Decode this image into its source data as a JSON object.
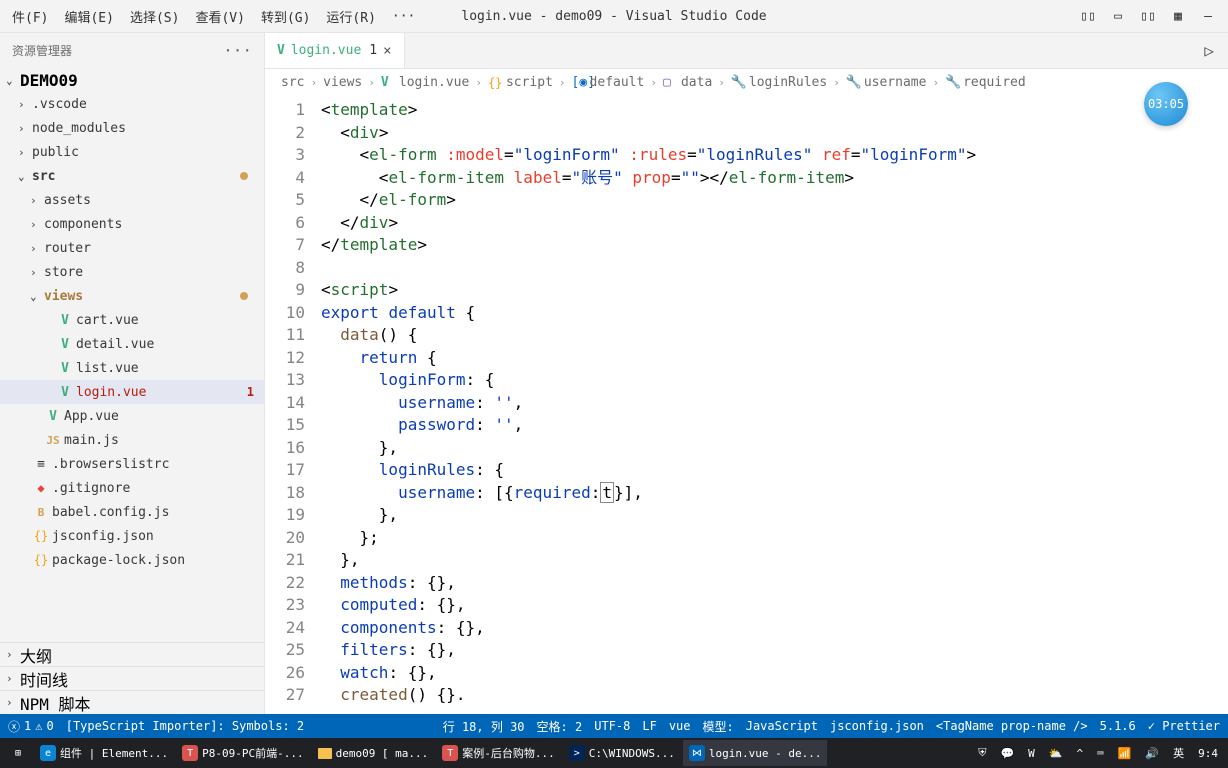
{
  "menubar": {
    "items": [
      "件(F)",
      "编辑(E)",
      "选择(S)",
      "查看(V)",
      "转到(G)",
      "运行(R)"
    ],
    "ellipsis": "···",
    "title": "login.vue - demo09 - Visual Studio Code"
  },
  "sidebar": {
    "header": "资源管理器",
    "project": "DEMO09",
    "tree": [
      {
        "indent": 1,
        "chev": "›",
        "label": ".vscode"
      },
      {
        "indent": 1,
        "chev": "›",
        "label": "node_modules"
      },
      {
        "indent": 1,
        "chev": "›",
        "label": "public"
      },
      {
        "indent": 1,
        "chev": "⌄",
        "label": "src",
        "dot": true,
        "bold": true
      },
      {
        "indent": 2,
        "chev": "›",
        "label": "assets"
      },
      {
        "indent": 2,
        "chev": "›",
        "label": "components"
      },
      {
        "indent": 2,
        "chev": "›",
        "label": "router"
      },
      {
        "indent": 2,
        "chev": "›",
        "label": "store"
      },
      {
        "indent": 2,
        "chev": "⌄",
        "label": "views",
        "dot": true,
        "bold": true,
        "color": "#a87a3c"
      },
      {
        "indent": 3,
        "icon": "V",
        "iconcls": "icon-v",
        "label": "cart.vue"
      },
      {
        "indent": 3,
        "icon": "V",
        "iconcls": "icon-v",
        "label": "detail.vue"
      },
      {
        "indent": 3,
        "icon": "V",
        "iconcls": "icon-v",
        "label": "list.vue"
      },
      {
        "indent": 3,
        "icon": "V",
        "iconcls": "icon-v",
        "label": "login.vue",
        "selected": true,
        "badge": "1",
        "color": "#b5200d"
      },
      {
        "indent": 2,
        "icon": "V",
        "iconcls": "icon-v",
        "label": "App.vue"
      },
      {
        "indent": 2,
        "icon": "JS",
        "iconcls": "icon-js2",
        "label": "main.js"
      },
      {
        "indent": 1,
        "icon": "≡",
        "iconcls": "",
        "label": ".browserslistrc"
      },
      {
        "indent": 1,
        "icon": "◆",
        "iconcls": "icon-git",
        "label": ".gitignore"
      },
      {
        "indent": 1,
        "icon": "B",
        "iconcls": "icon-js2",
        "label": "babel.config.js"
      },
      {
        "indent": 1,
        "icon": "{}",
        "iconcls": "icon-json",
        "label": "jsconfig.json"
      },
      {
        "indent": 1,
        "icon": "{}",
        "iconcls": "icon-json",
        "label": "package-lock.json"
      }
    ],
    "sections": [
      "大纲",
      "时间线",
      "NPM 脚本"
    ]
  },
  "tab": {
    "icon": "V",
    "label": "login.vue",
    "mod": "1"
  },
  "breadcrumb": [
    {
      "label": "src"
    },
    {
      "label": "views"
    },
    {
      "icon": "V",
      "label": "login.vue",
      "iconcls": "icon-v"
    },
    {
      "icon": "{}",
      "label": "script",
      "iconcls": "icon-json"
    },
    {
      "icon": "[◉]",
      "label": "default",
      "color": "#0a6dc2"
    },
    {
      "icon": "▢",
      "label": "data",
      "color": "#7a60c9"
    },
    {
      "icon": "🔧",
      "label": "loginRules"
    },
    {
      "icon": "🔧",
      "label": "username"
    },
    {
      "icon": "🔧",
      "label": "required"
    }
  ],
  "timer": "03:05",
  "code": {
    "lines": [
      {
        "n": 1,
        "html": "<span class='punc'>&lt;</span><span class='tag'>template</span><span class='punc'>&gt;</span>"
      },
      {
        "n": 2,
        "html": "  <span class='punc'>&lt;</span><span class='tag'>div</span><span class='punc'>&gt;</span>"
      },
      {
        "n": 3,
        "html": "    <span class='punc'>&lt;</span><span class='tag'>el-form</span> <span class='attr'>:model</span>=<span class='str'>\"loginForm\"</span> <span class='attr'>:rules</span>=<span class='str'>\"loginRules\"</span> <span class='attr'>ref</span>=<span class='str'>\"loginForm\"</span><span class='punc'>&gt;</span>"
      },
      {
        "n": 4,
        "html": "      <span class='punc'>&lt;</span><span class='tag'>el-form-item</span> <span class='attr'>label</span>=<span class='str'>\"账号\"</span> <span class='attr'>prop</span>=<span class='str'>\"\"</span><span class='punc'>&gt;&lt;/</span><span class='tag'>el-form-item</span><span class='punc'>&gt;</span>"
      },
      {
        "n": 5,
        "html": "    <span class='punc'>&lt;/</span><span class='tag'>el-form</span><span class='punc'>&gt;</span>"
      },
      {
        "n": 6,
        "html": "  <span class='punc'>&lt;/</span><span class='tag'>div</span><span class='punc'>&gt;</span>"
      },
      {
        "n": 7,
        "html": "<span class='punc'>&lt;/</span><span class='tag'>template</span><span class='punc'>&gt;</span>"
      },
      {
        "n": 8,
        "html": ""
      },
      {
        "n": 9,
        "html": "<span class='punc'>&lt;</span><span class='tag'>script</span><span class='punc'>&gt;</span>"
      },
      {
        "n": 10,
        "html": "<span class='kw'>export</span> <span class='kw'>default</span> {"
      },
      {
        "n": 11,
        "html": "  <span class='fn'>data</span>() {"
      },
      {
        "n": 12,
        "html": "    <span class='kw'>return</span> {"
      },
      {
        "n": 13,
        "html": "      <span class='prop'>loginForm</span>: {"
      },
      {
        "n": 14,
        "html": "        <span class='prop'>username</span>: <span class='str'>''</span>,"
      },
      {
        "n": 15,
        "html": "        <span class='prop'>password</span>: <span class='str'>''</span>,"
      },
      {
        "n": 16,
        "html": "      },"
      },
      {
        "n": 17,
        "html": "      <span class='prop'>loginRules</span>: {"
      },
      {
        "n": 18,
        "html": "        <span class='prop'>username</span>: [{<span class='prop'>required</span>:<span class='cursor-box'>t</span>}],"
      },
      {
        "n": 19,
        "html": "      },"
      },
      {
        "n": 20,
        "html": "    };"
      },
      {
        "n": 21,
        "html": "  },"
      },
      {
        "n": 22,
        "html": "  <span class='prop'>methods</span>: {},"
      },
      {
        "n": 23,
        "html": "  <span class='prop'>computed</span>: {},"
      },
      {
        "n": 24,
        "html": "  <span class='prop'>components</span>: {},"
      },
      {
        "n": 25,
        "html": "  <span class='prop'>filters</span>: {},"
      },
      {
        "n": 26,
        "html": "  <span class='prop'>watch</span>: {},"
      },
      {
        "n": 27,
        "html": "  <span class='fn'>created</span>() {}."
      }
    ]
  },
  "statusbar": {
    "errors": "1",
    "warnings": "0",
    "importer": "[TypeScript Importer]: Symbols: 2",
    "pos": "行 18, 列 30",
    "spaces": "空格: 2",
    "enc": "UTF-8",
    "eol": "LF",
    "lang": "vue",
    "model": "模型:",
    "js": "JavaScript",
    "jsconfig": "jsconfig.json",
    "tagname": "<TagName prop-name />",
    "ver": "5.1.6",
    "prettier": "✓ Prettier"
  },
  "taskbar": {
    "items": [
      {
        "icon": "⊞",
        "cls": "win"
      },
      {
        "icon": "e",
        "label": "组件 | Element...",
        "bg": "#0a84d4"
      },
      {
        "icon": "T",
        "label": "P8-09-PC前端-...",
        "bg": "#d9534f"
      },
      {
        "folder": true,
        "label": "demo09 [ ma..."
      },
      {
        "icon": "T",
        "label": "案例-后台购物...",
        "bg": "#d9534f"
      },
      {
        "icon": ">",
        "label": "C:\\WINDOWS...",
        "bg": "#012456"
      },
      {
        "icon": "⋈",
        "label": "login.vue - de...",
        "bg": "#0066b8",
        "active": true
      }
    ],
    "right": [
      "⛨",
      "💬",
      "W",
      "⛅",
      "^",
      "⌨",
      "📶",
      "🔊",
      "英",
      "9:4"
    ]
  }
}
